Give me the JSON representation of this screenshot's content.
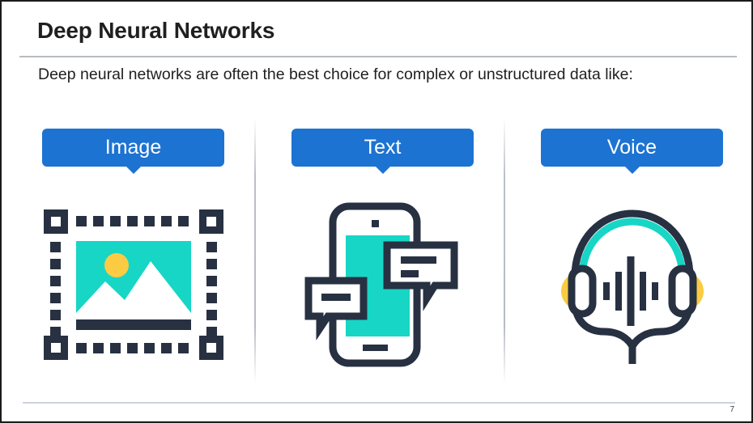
{
  "slide": {
    "title": "Deep Neural Networks",
    "subtitle": "Deep neural networks are often the best choice for complex or unstructured data like:",
    "page_number": "7",
    "colors": {
      "badge_blue": "#1d73d2",
      "icon_dark": "#273142",
      "icon_teal": "#17d6c6",
      "icon_yellow": "#fbcb43",
      "rule_gray": "#b8bcc0",
      "footer_rule": "#ccd2d8",
      "text": "#1f1f1f"
    }
  },
  "columns": [
    {
      "label": "Image",
      "icon": "image-frame-icon",
      "icon_description": "Dashed selection frame with corner handles around a teal photo with white mountains and a yellow sun"
    },
    {
      "label": "Text",
      "icon": "phone-chat-icon",
      "icon_description": "Smartphone with teal screen and two chat speech bubbles"
    },
    {
      "label": "Voice",
      "icon": "headset-waveform-icon",
      "icon_description": "Headset with teal headband, yellow ear cups, audio waveform and microphone boom"
    }
  ]
}
